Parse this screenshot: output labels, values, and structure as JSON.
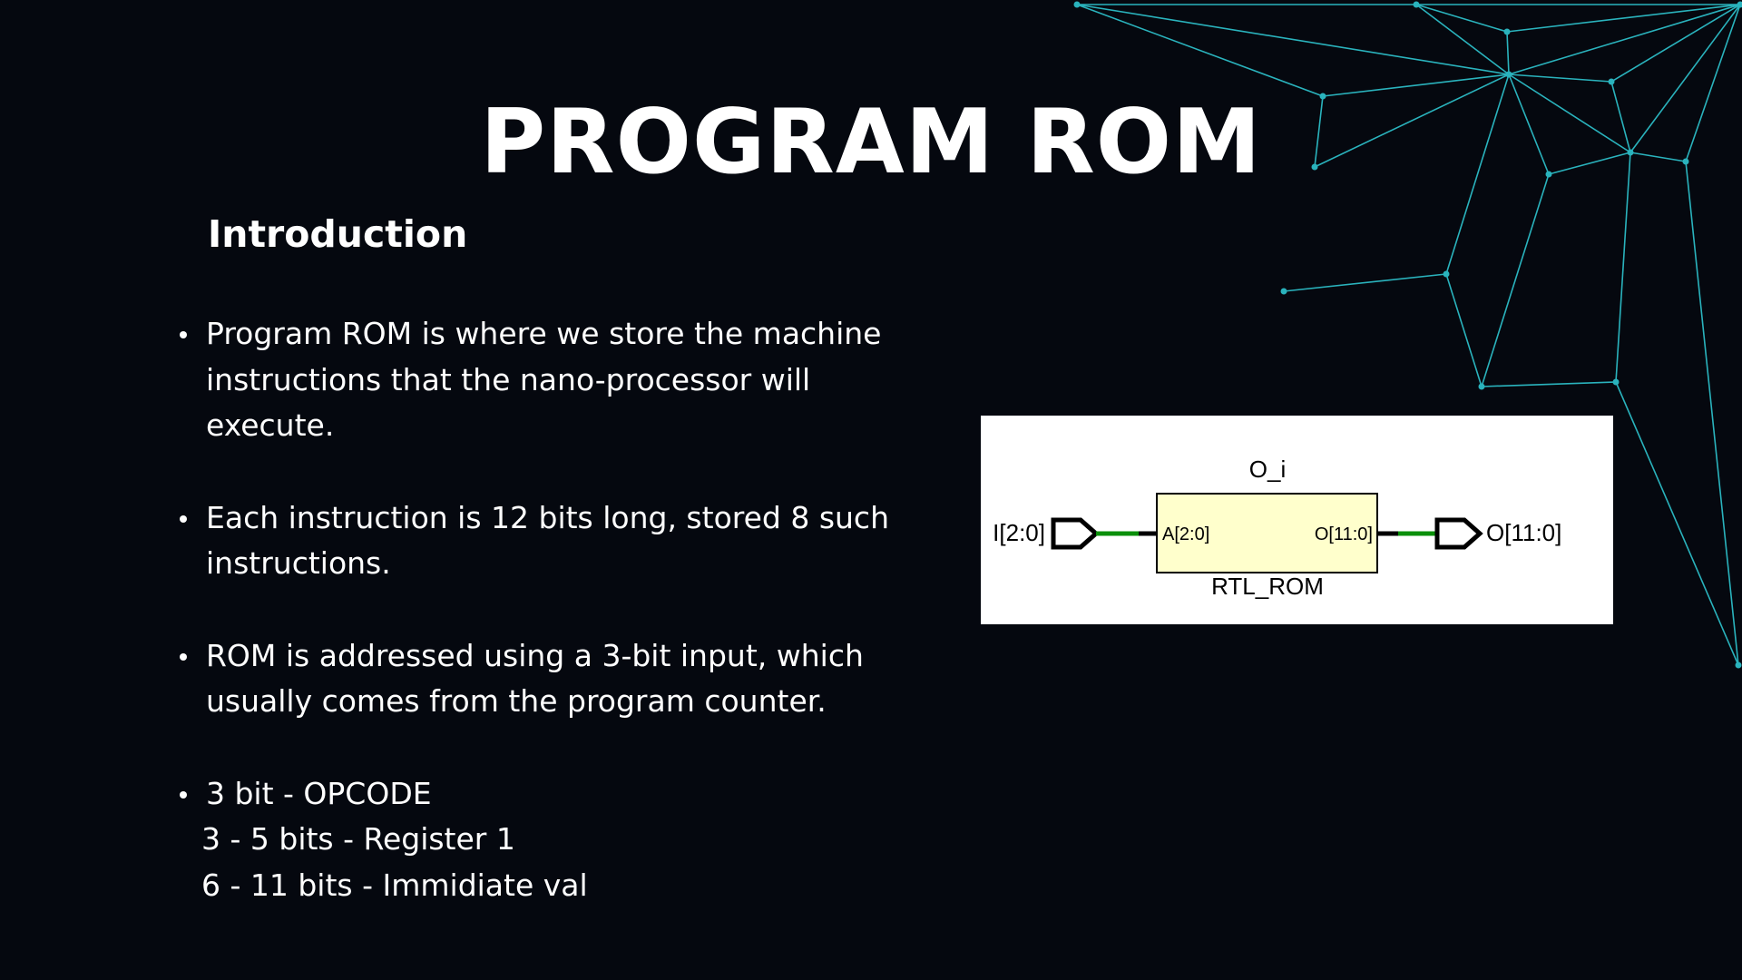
{
  "slide": {
    "title": "PROGRAM ROM",
    "subtitle": "Introduction",
    "bullets": [
      "Program ROM is where we store the machine instructions that the nano-processor will execute.",
      "Each instruction is 12 bits long, stored 8 such instructions.",
      "ROM is addressed using a 3-bit input, which usually comes from the program counter."
    ],
    "bit_fields": [
      "3 bit - OPCODE",
      "3 - 5 bits - Register 1",
      "6 - 11 bits - Immidiate val"
    ]
  },
  "diagram": {
    "instance_name": "O_i",
    "cell_type": "RTL_ROM",
    "input_port": "I[2:0]",
    "output_port": "O[11:0]",
    "address_pin": "A[2:0]",
    "data_pin": "O[11:0]"
  },
  "colors": {
    "background": "#05080f",
    "text": "#ffffff",
    "network": "#2ab3bd",
    "block_fill": "#ffffcc",
    "wire": "#0a8f0a"
  }
}
